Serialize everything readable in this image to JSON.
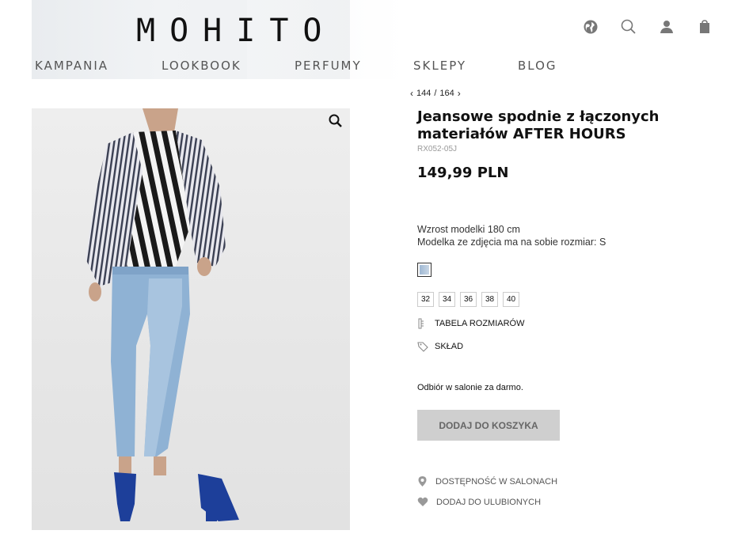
{
  "header": {
    "logo": "MOHITO",
    "nav": [
      "KAMPANIA",
      "LOOKBOOK",
      "PERFUMY",
      "SKLEPY",
      "BLOG"
    ],
    "icons": [
      "globe-icon",
      "search-icon",
      "account-icon",
      "bag-icon"
    ]
  },
  "pager": {
    "current": "144",
    "total": "164",
    "separator": "/"
  },
  "product": {
    "title": "Jeansowe spodnie z łączonych materiałów AFTER HOURS",
    "sku": "RX052-05J",
    "price": "149,99 PLN",
    "model_height": "Wzrost modelki 180 cm",
    "model_size": "Modelka ze zdjęcia ma na sobie rozmiar: S",
    "sizes": [
      "32",
      "34",
      "36",
      "38",
      "40"
    ],
    "size_table": "TABELA ROZMIARÓW",
    "composition": "SKŁAD",
    "pickup": "Odbiór w salonie za darmo.",
    "add_to_cart": "DODAJ DO KOSZYKA",
    "availability": "DOSTĘPNOŚĆ W SALONACH",
    "favorites": "DODAJ DO ULUBIONYCH"
  },
  "colors": {
    "accent_button": "#cfcfcf",
    "denim": "#8fb2d4",
    "sandal": "#1d3f9a"
  }
}
